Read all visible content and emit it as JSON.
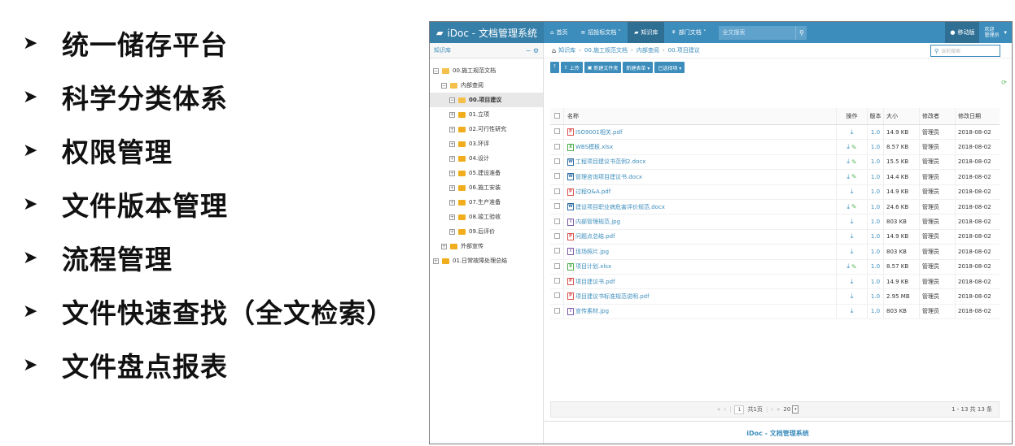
{
  "features": [
    {
      "arrow": "➤",
      "text": "统一储存平台"
    },
    {
      "arrow": "➤",
      "text": "科学分类体系"
    },
    {
      "arrow": "➤",
      "text": "权限管理"
    },
    {
      "arrow": "➤",
      "text": "文件版本管理"
    },
    {
      "arrow": "➤",
      "text": "流程管理"
    },
    {
      "arrow": "➤",
      "text": "文件快速查找（全文检索）"
    },
    {
      "arrow": "➤",
      "text": "文件盘点报表"
    }
  ],
  "app": {
    "brand": "iDoc - 文档管理系统",
    "nav": [
      {
        "icon": "home-icon",
        "label": "首页"
      },
      {
        "icon": "list-icon",
        "label": "招投标文档 ˅"
      },
      {
        "icon": "book-icon",
        "label": "知识库"
      },
      {
        "icon": "sitemap-icon",
        "label": "部门文档 ˅"
      }
    ],
    "search_placeholder": "全文搜索",
    "mobile_label": "移动版",
    "user_line1": "欢迎",
    "user_line2": "管理员",
    "colors": {
      "topbar": "#3c8dbc",
      "accent": "#3c8dbc"
    }
  },
  "sidebar": {
    "title": "知识库",
    "tree": [
      {
        "label": "00.施工规范文档",
        "exp": "−",
        "open": true
      },
      {
        "label": "内部查阅",
        "exp": "−",
        "open": true
      },
      {
        "label": "00.项目建议",
        "exp": "−",
        "open": true
      },
      {
        "label": "01.立项",
        "exp": "+",
        "open": false
      },
      {
        "label": "02.可行性研究",
        "exp": "+",
        "open": false
      },
      {
        "label": "03.环评",
        "exp": "+",
        "open": false
      },
      {
        "label": "04.设计",
        "exp": "+",
        "open": false
      },
      {
        "label": "05.建设准备",
        "exp": "+",
        "open": false
      },
      {
        "label": "06.施工安装",
        "exp": "+",
        "open": false
      },
      {
        "label": "07.生产准备",
        "exp": "+",
        "open": false
      },
      {
        "label": "08.竣工验收",
        "exp": "+",
        "open": false
      },
      {
        "label": "09.后评价",
        "exp": "+",
        "open": false
      },
      {
        "label": "外部宣传",
        "exp": "+",
        "open": false
      },
      {
        "label": "01.日常故障处理总结",
        "exp": "+",
        "open": false
      }
    ]
  },
  "breadcrumb": [
    "知识库",
    "00.施工规范文档",
    "内部查阅",
    "00.项目建议"
  ],
  "current_search_placeholder": "当前搜索",
  "toolbar": {
    "up": "⤒",
    "upload": "上传",
    "new_folder": "新建文件夹",
    "new_form": "新建表单 ▾",
    "selected": "已选择项 ▾"
  },
  "table": {
    "headers": {
      "name": "名称",
      "op": "操作",
      "ver": "版本",
      "size": "大小",
      "modifier": "修改者",
      "date": "修改日期"
    },
    "rows": [
      {
        "type": "pdf",
        "name": "ISO9001相关.pdf",
        "edit": false,
        "ver": "1.0",
        "size": "14.9 KB",
        "modifier": "管理员",
        "date": "2018-08-02"
      },
      {
        "type": "xls",
        "name": "WBS模板.xlsx",
        "edit": true,
        "ver": "1.0",
        "size": "8.57 KB",
        "modifier": "管理员",
        "date": "2018-08-02"
      },
      {
        "type": "doc",
        "name": "工程项目建议书范例2.docx",
        "edit": true,
        "ver": "1.0",
        "size": "15.5 KB",
        "modifier": "管理员",
        "date": "2018-08-02"
      },
      {
        "type": "doc",
        "name": "管理咨询项目建议书.docx",
        "edit": true,
        "ver": "1.0",
        "size": "14.4 KB",
        "modifier": "管理员",
        "date": "2018-08-02"
      },
      {
        "type": "pdf",
        "name": "过程Q&A.pdf",
        "edit": false,
        "ver": "1.0",
        "size": "14.9 KB",
        "modifier": "管理员",
        "date": "2018-08-02"
      },
      {
        "type": "doc",
        "name": "建设项目职业病危害评价规范.docx",
        "edit": true,
        "ver": "1.0",
        "size": "24.6 KB",
        "modifier": "管理员",
        "date": "2018-08-02"
      },
      {
        "type": "jpg",
        "name": "内部管理规范.jpg",
        "edit": false,
        "ver": "1.0",
        "size": "803 KB",
        "modifier": "管理员",
        "date": "2018-08-02"
      },
      {
        "type": "pdf",
        "name": "问题点总结.pdf",
        "edit": false,
        "ver": "1.0",
        "size": "14.9 KB",
        "modifier": "管理员",
        "date": "2018-08-02"
      },
      {
        "type": "jpg",
        "name": "现场照片.jpg",
        "edit": false,
        "ver": "1.0",
        "size": "803 KB",
        "modifier": "管理员",
        "date": "2018-08-02"
      },
      {
        "type": "xls",
        "name": "项目计划.xlsx",
        "edit": true,
        "ver": "1.0",
        "size": "8.57 KB",
        "modifier": "管理员",
        "date": "2018-08-02"
      },
      {
        "type": "pdf",
        "name": "项目建议书.pdf",
        "edit": false,
        "ver": "1.0",
        "size": "14.9 KB",
        "modifier": "管理员",
        "date": "2018-08-02"
      },
      {
        "type": "pdf",
        "name": "项目建议书标准规范说明.pdf",
        "edit": false,
        "ver": "1.0",
        "size": "2.95 MB",
        "modifier": "管理员",
        "date": "2018-08-02"
      },
      {
        "type": "jpg",
        "name": "宣传素材.jpg",
        "edit": false,
        "ver": "1.0",
        "size": "803 KB",
        "modifier": "管理员",
        "date": "2018-08-02"
      }
    ]
  },
  "pager": {
    "first": "«",
    "prev": "‹",
    "page": "1",
    "total_pages": "共1页",
    "next": "›",
    "last": "»",
    "page_size": "20",
    "info": "1 - 13  共 13 条"
  },
  "footer": "iDoc - 文档管理系统"
}
